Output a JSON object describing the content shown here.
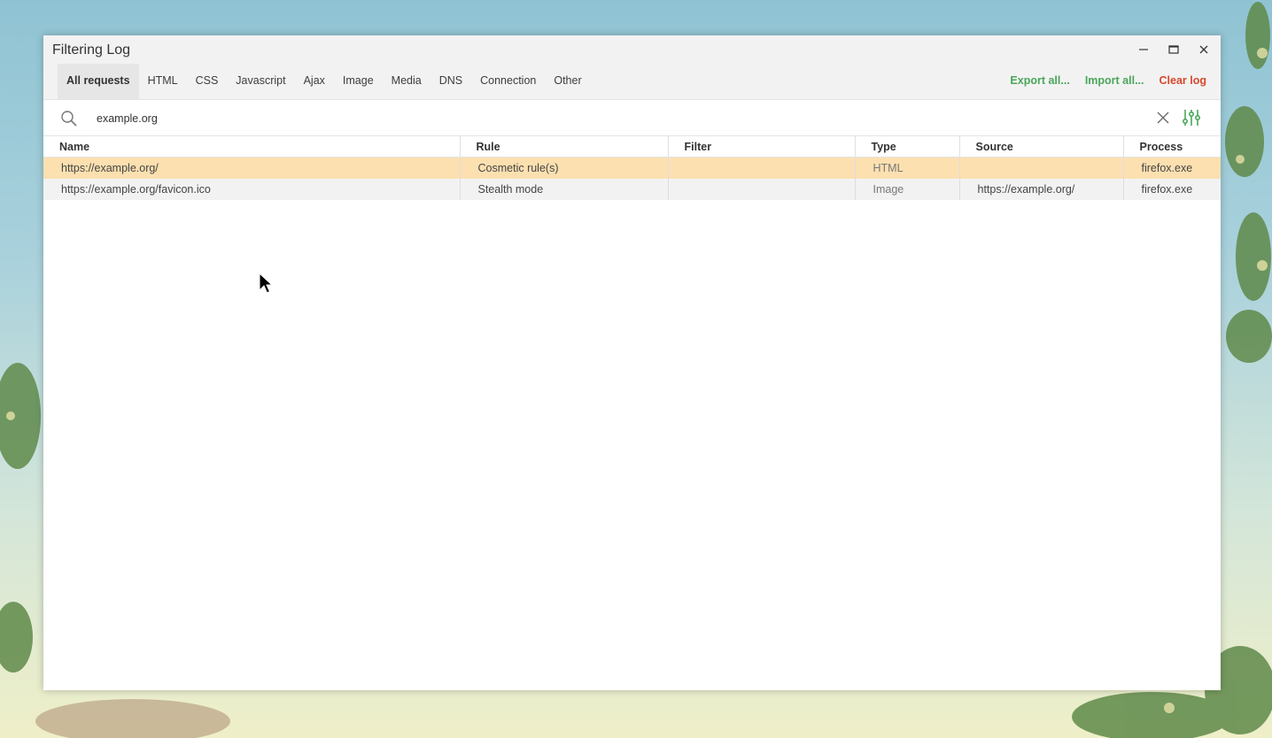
{
  "window": {
    "title": "Filtering Log",
    "controls": [
      "minimize-icon",
      "maximize-icon",
      "close-icon"
    ]
  },
  "tabs": [
    {
      "label": "All requests",
      "active": true
    },
    {
      "label": "HTML"
    },
    {
      "label": "CSS"
    },
    {
      "label": "Javascript"
    },
    {
      "label": "Ajax"
    },
    {
      "label": "Image"
    },
    {
      "label": "Media"
    },
    {
      "label": "DNS"
    },
    {
      "label": "Connection"
    },
    {
      "label": "Other"
    }
  ],
  "actions": {
    "export": {
      "label": "Export all...",
      "color": "#4aa65a"
    },
    "import": {
      "label": "Import all...",
      "color": "#4aa65a"
    },
    "clear": {
      "label": "Clear log",
      "color": "#d9472b"
    }
  },
  "search": {
    "value": "example.org",
    "icon": "search-icon",
    "clear_icon": "close-icon",
    "settings_icon": "filter-settings-icon"
  },
  "table": {
    "headers": [
      "Name",
      "Rule",
      "Filter",
      "Type",
      "Source",
      "Process"
    ],
    "rows": [
      {
        "name": "https://example.org/",
        "rule": "Cosmetic rule(s)",
        "filter": "",
        "type": "HTML",
        "source": "",
        "process": "firefox.exe",
        "highlight_color": "#fde0b0"
      },
      {
        "name": "https://example.org/favicon.ico",
        "rule": "Stealth mode",
        "filter": "",
        "type": "Image",
        "source": "https://example.org/",
        "process": "firefox.exe",
        "highlight_color": "#f2f2f2"
      }
    ]
  },
  "colors": {
    "accent_green": "#4aa65a",
    "danger_red": "#d9472b",
    "titlebar_bg": "#f2f2f2"
  }
}
